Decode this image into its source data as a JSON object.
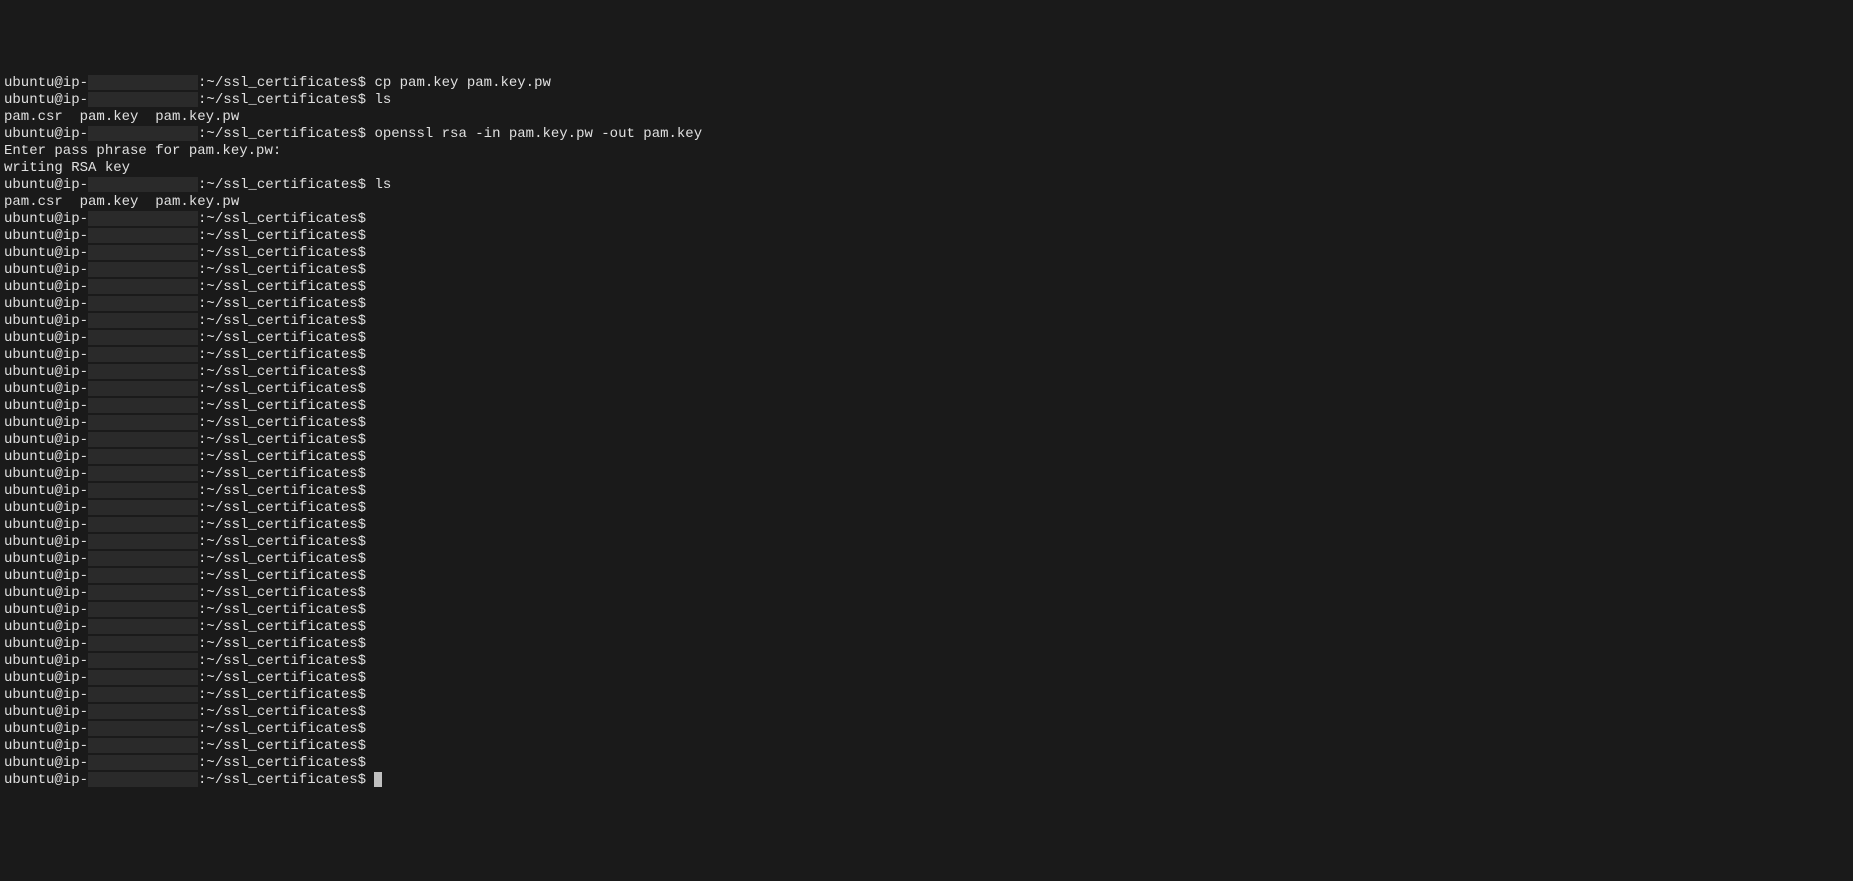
{
  "prompt": {
    "user_host_prefix": "ubuntu@ip-",
    "redacted_placeholder": "              ",
    "path_suffix": ":~/ssl_certificates$"
  },
  "lines": [
    {
      "type": "prompt_cmd",
      "cmd": " cp pam.key pam.key.pw"
    },
    {
      "type": "prompt_cmd",
      "cmd": " ls"
    },
    {
      "type": "output",
      "text": "pam.csr  pam.key  pam.key.pw"
    },
    {
      "type": "prompt_cmd",
      "cmd": " openssl rsa -in pam.key.pw -out pam.key"
    },
    {
      "type": "output",
      "text": "Enter pass phrase for pam.key.pw:"
    },
    {
      "type": "output",
      "text": "writing RSA key"
    },
    {
      "type": "prompt_cmd",
      "cmd": " ls"
    },
    {
      "type": "output",
      "text": "pam.csr  pam.key  pam.key.pw"
    },
    {
      "type": "prompt_cmd",
      "cmd": ""
    },
    {
      "type": "prompt_cmd",
      "cmd": ""
    },
    {
      "type": "prompt_cmd",
      "cmd": ""
    },
    {
      "type": "prompt_cmd",
      "cmd": ""
    },
    {
      "type": "prompt_cmd",
      "cmd": ""
    },
    {
      "type": "prompt_cmd",
      "cmd": ""
    },
    {
      "type": "prompt_cmd",
      "cmd": ""
    },
    {
      "type": "prompt_cmd",
      "cmd": ""
    },
    {
      "type": "prompt_cmd",
      "cmd": ""
    },
    {
      "type": "prompt_cmd",
      "cmd": ""
    },
    {
      "type": "prompt_cmd",
      "cmd": ""
    },
    {
      "type": "prompt_cmd",
      "cmd": ""
    },
    {
      "type": "prompt_cmd",
      "cmd": ""
    },
    {
      "type": "prompt_cmd",
      "cmd": ""
    },
    {
      "type": "prompt_cmd",
      "cmd": ""
    },
    {
      "type": "prompt_cmd",
      "cmd": ""
    },
    {
      "type": "prompt_cmd",
      "cmd": ""
    },
    {
      "type": "prompt_cmd",
      "cmd": ""
    },
    {
      "type": "prompt_cmd",
      "cmd": ""
    },
    {
      "type": "prompt_cmd",
      "cmd": ""
    },
    {
      "type": "prompt_cmd",
      "cmd": ""
    },
    {
      "type": "prompt_cmd",
      "cmd": ""
    },
    {
      "type": "prompt_cmd",
      "cmd": ""
    },
    {
      "type": "prompt_cmd",
      "cmd": ""
    },
    {
      "type": "prompt_cmd",
      "cmd": ""
    },
    {
      "type": "prompt_cmd",
      "cmd": ""
    },
    {
      "type": "prompt_cmd",
      "cmd": ""
    },
    {
      "type": "prompt_cmd",
      "cmd": ""
    },
    {
      "type": "prompt_cmd",
      "cmd": ""
    },
    {
      "type": "prompt_cmd",
      "cmd": ""
    },
    {
      "type": "prompt_cmd",
      "cmd": ""
    },
    {
      "type": "prompt_cmd",
      "cmd": ""
    },
    {
      "type": "prompt_cmd",
      "cmd": ""
    },
    {
      "type": "prompt_cmd_cursor",
      "cmd": " "
    }
  ]
}
